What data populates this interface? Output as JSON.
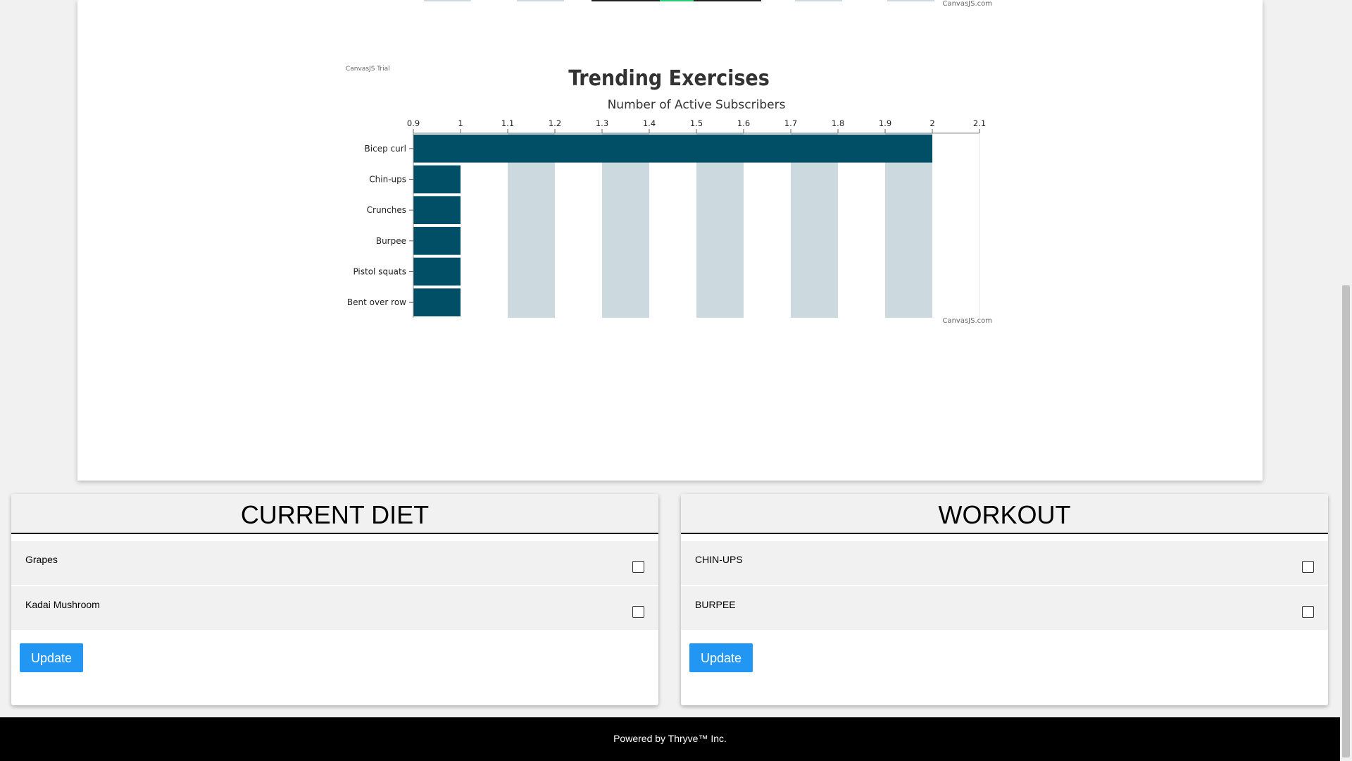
{
  "top_chart_remnant": {
    "credit": "CanvasJS.com"
  },
  "chart_data": {
    "type": "bar",
    "orientation": "horizontal",
    "trial_label": "CanvasJS Trial",
    "title": "Trending Exercises",
    "xlabel": "Number of Active Subscribers",
    "ylabel": "",
    "categories": [
      "Bicep curl",
      "Chin-ups",
      "Crunches",
      "Burpee",
      "Pistol squats",
      "Bent over row"
    ],
    "values": [
      2,
      1,
      1,
      1,
      1,
      1
    ],
    "xlim": [
      0.9,
      2.1
    ],
    "ticks": [
      "0.9",
      "1",
      "1.1",
      "1.2",
      "1.3",
      "1.4",
      "1.5",
      "1.6",
      "1.7",
      "1.8",
      "1.9",
      "2",
      "2.1"
    ],
    "axis_position": "top",
    "interlaced_bands": true,
    "bar_color": "#004f66",
    "band_color": "#ccdadf",
    "credit": "CanvasJS.com"
  },
  "diet_panel": {
    "title": "CURRENT DIET",
    "items": [
      {
        "label": "Grapes",
        "checked": false
      },
      {
        "label": "Kadai Mushroom",
        "checked": false
      }
    ],
    "update_label": "Update"
  },
  "workout_panel": {
    "title": "WORKOUT",
    "items": [
      {
        "label": "CHIN-UPS",
        "checked": false
      },
      {
        "label": "BURPEE",
        "checked": false
      }
    ],
    "update_label": "Update"
  },
  "footer": {
    "text": "Powered by Thryve™ Inc."
  },
  "colors": {
    "accent": "#2196F3",
    "footer_bg": "#000000"
  }
}
